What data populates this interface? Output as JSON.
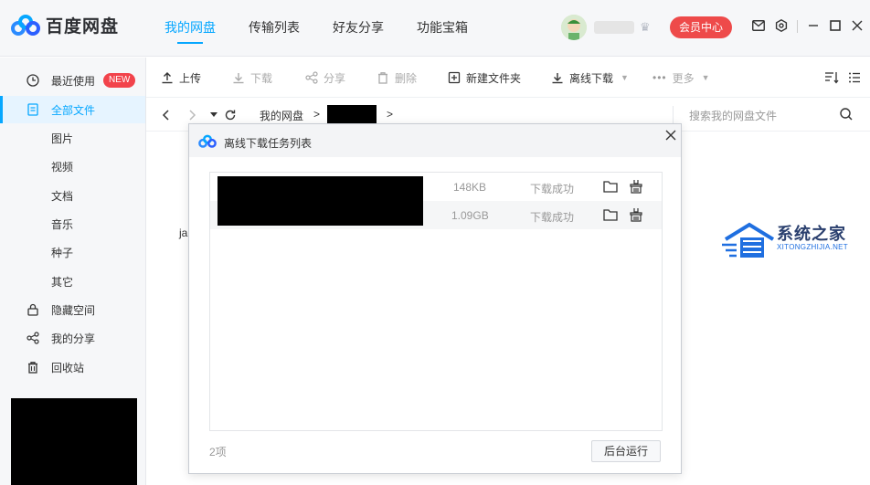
{
  "app": {
    "name": "百度网盘"
  },
  "nav": {
    "tabs": [
      "我的网盘",
      "传输列表",
      "好友分享",
      "功能宝箱"
    ]
  },
  "header": {
    "vip_label": "会员中心"
  },
  "sidebar": {
    "recent": "最近使用",
    "new_badge": "NEW",
    "all_files": "全部文件",
    "categories": [
      "图片",
      "视频",
      "文档",
      "音乐",
      "种子",
      "其它"
    ],
    "hidden_space": "隐藏空间",
    "my_share": "我的分享",
    "recycle_bin": "回收站"
  },
  "toolbar": {
    "upload": "上传",
    "download": "下载",
    "share": "分享",
    "delete": "删除",
    "new_folder": "新建文件夹",
    "offline_download": "离线下载",
    "more": "更多"
  },
  "path": {
    "root": "我的网盘",
    "separator": ">",
    "search_placeholder": "搜索我的网盘文件"
  },
  "content": {
    "partial_text": "ja"
  },
  "dialog": {
    "title": "离线下载任务列表",
    "tasks": [
      {
        "size": "148KB",
        "status": "下载成功"
      },
      {
        "size": "1.09GB",
        "status": "下载成功"
      }
    ],
    "count": "2项",
    "background_button": "后台运行"
  },
  "watermark": {
    "title": "系统之家",
    "subtitle": "XITONGZHIJIA.NET"
  },
  "colors": {
    "accent": "#06a7ff",
    "vip": "#ee4a4a",
    "new_badge": "#f2434b"
  }
}
